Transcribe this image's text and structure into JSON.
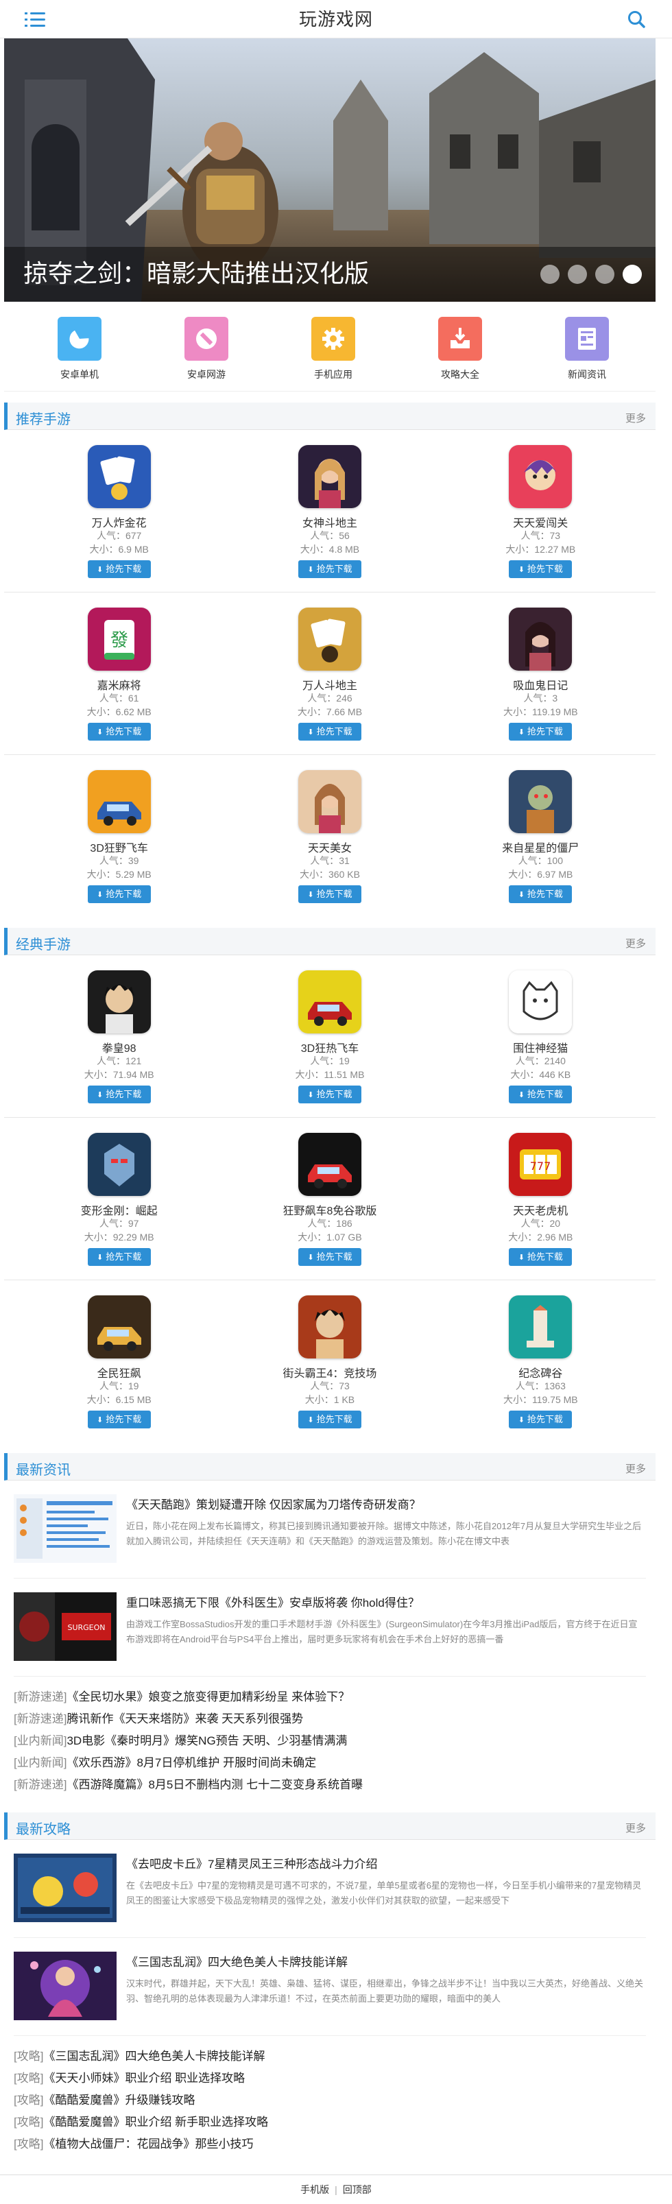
{
  "header": {
    "title": "玩游戏网"
  },
  "banner": {
    "caption": "掠夺之剑：暗影大陆推出汉化版",
    "dots": 4,
    "active_dot": 4
  },
  "quick": [
    {
      "label": "安卓单机",
      "color": "#4ab3f2",
      "icon": "pacman-icon"
    },
    {
      "label": "安卓网游",
      "color": "#ee8ac4",
      "icon": "tag-icon"
    },
    {
      "label": "手机应用",
      "color": "#f7b731",
      "icon": "gear-icon"
    },
    {
      "label": "攻略大全",
      "color": "#f46d5e",
      "icon": "inbox-icon"
    },
    {
      "label": "新闻资讯",
      "color": "#9a91e6",
      "icon": "document-icon"
    }
  ],
  "sections": {
    "recommend": {
      "title": "推荐手游",
      "more": "更多"
    },
    "classic": {
      "title": "经典手游",
      "more": "更多"
    },
    "news": {
      "title": "最新资讯",
      "more": "更多"
    },
    "guides": {
      "title": "最新攻略",
      "more": "更多"
    }
  },
  "download_label": "抢先下载",
  "popularity_prefix": "人气：",
  "size_prefix": "大小：",
  "recommend_apps": [
    {
      "name": "万人炸金花",
      "pop": "677",
      "size": "6.9 MB",
      "c1": "#2a5bb8",
      "c2": "#f2c23a",
      "icon": "cards-icon"
    },
    {
      "name": "女神斗地主",
      "pop": "56",
      "size": "4.8 MB",
      "c1": "#2b1f3a",
      "c2": "#d9a35b",
      "icon": "girl-icon"
    },
    {
      "name": "天天爱闯关",
      "pop": "73",
      "size": "12.27 MB",
      "c1": "#e8405a",
      "c2": "#6b3fa0",
      "icon": "character-icon"
    },
    {
      "name": "嘉米麻将",
      "pop": "61",
      "size": "6.62 MB",
      "c1": "#b3195a",
      "c2": "#f4d6e0",
      "icon": "mahjong-icon"
    },
    {
      "name": "万人斗地主",
      "pop": "246",
      "size": "7.66 MB",
      "c1": "#d4a33c",
      "c2": "#3b2a16",
      "icon": "cards-icon"
    },
    {
      "name": "吸血鬼日记",
      "pop": "3",
      "size": "119.19 MB",
      "c1": "#3a2230",
      "c2": "#b54d5c",
      "icon": "vampire-icon"
    },
    {
      "name": "3D狂野飞车",
      "pop": "39",
      "size": "5.29 MB",
      "c1": "#f1a020",
      "c2": "#2d5fb0",
      "icon": "car-icon"
    },
    {
      "name": "天天美女",
      "pop": "31",
      "size": "360 KB",
      "c1": "#e8c9a8",
      "c2": "#a86b3d",
      "icon": "girl-icon"
    },
    {
      "name": "来自星星的僵尸",
      "pop": "100",
      "size": "6.97 MB",
      "c1": "#314a6b",
      "c2": "#c27a34",
      "icon": "zombie-icon"
    }
  ],
  "classic_apps": [
    {
      "name": "拳皇98",
      "pop": "121",
      "size": "71.94 MB",
      "c1": "#1c1c1c",
      "c2": "#e8e8e8",
      "icon": "fighter-icon"
    },
    {
      "name": "3D狂热飞车",
      "pop": "19",
      "size": "11.51 MB",
      "c1": "#e6d21a",
      "c2": "#c02020",
      "icon": "car-icon"
    },
    {
      "name": "围住神经猫",
      "pop": "2140",
      "size": "446 KB",
      "c1": "#ffffff",
      "c2": "#333333",
      "icon": "cat-icon"
    },
    {
      "name": "变形金刚：崛起",
      "pop": "97",
      "size": "92.29 MB",
      "c1": "#1d3b5a",
      "c2": "#7da6cf",
      "icon": "robot-icon"
    },
    {
      "name": "狂野飙车8免谷歌版",
      "pop": "186",
      "size": "1.07 GB",
      "c1": "#121212",
      "c2": "#e03030",
      "icon": "car-icon"
    },
    {
      "name": "天天老虎机",
      "pop": "20",
      "size": "2.96 MB",
      "c1": "#c81a1a",
      "c2": "#f5c518",
      "icon": "slot-icon"
    },
    {
      "name": "全民狂飙",
      "pop": "19",
      "size": "6.15 MB",
      "c1": "#3a2a1a",
      "c2": "#e8b040",
      "icon": "car-icon"
    },
    {
      "name": "街头霸王4：竞技场",
      "pop": "73",
      "size": "1 KB",
      "c1": "#a83a1a",
      "c2": "#e8c08a",
      "icon": "fighter-icon"
    },
    {
      "name": "纪念碑谷",
      "pop": "1363",
      "size": "119.75 MB",
      "c1": "#1ba39c",
      "c2": "#f2e8d8",
      "icon": "monument-icon"
    }
  ],
  "news": [
    {
      "title": "《天天酷跑》策划疑遭开除 仅因家属为刀塔传奇研发商？",
      "summary": "近日，陈小花在网上发布长篇博文，称其已接到腾讯通知要被开除。据博文中陈述，陈小花自2012年7月从复旦大学研究生毕业之后就加入腾讯公司，并陆续担任《天天连萌》和《天天酷跑》的游戏运营及策划。陈小花在博文中表",
      "thumb": "light"
    },
    {
      "title": "重口味恶搞无下限《外科医生》安卓版将袭 你hold得住？",
      "summary": "由游戏工作室BossaStudios开发的重口手术题材手游《外科医生》(SurgeonSimulator)在今年3月推出iPad版后，官方终于在近日宣布游戏即将在Android平台与PS4平台上推出，届时更多玩家将有机会在手术台上好好的恶搞一番",
      "thumb": "surgeon"
    }
  ],
  "news_links": [
    {
      "tag": "[新游速递]",
      "text": "《全民切水果》娘变之旅变得更加精彩纷呈 来体验下？"
    },
    {
      "tag": "[新游速递]",
      "text": "腾讯新作《天天来塔防》来袭 天天系列很强势"
    },
    {
      "tag": "[业内新闻]",
      "text": "3D电影《秦时明月》爆笑NG预告 天明、少羽基情满满"
    },
    {
      "tag": "[业内新闻]",
      "text": "《欢乐西游》8月7日停机维护 开服时间尚未确定"
    },
    {
      "tag": "[新游速递]",
      "text": "《西游降魔篇》8月5日不删档内测 七十二变变身系统首曝"
    }
  ],
  "guides": [
    {
      "title": "《去吧皮卡丘》7星精灵凤王三种形态战斗力介绍",
      "summary": "在《去吧皮卡丘》中7星的宠物精灵是可遇不可求的，不说7星，单单5星或者6星的宠物也一样，今日至手机小编带来的7星宠物精灵凤王的图鉴让大家感受下极品宠物精灵的强悍之处，激发小伙伴们对其获取的欲望，一起来感受下",
      "thumb": "pika"
    },
    {
      "title": "《三国志乱润》四大绝色美人卡牌技能详解",
      "summary": "汉末时代，群雄并起，天下大乱！英雄、枭雄、猛将、谋臣，相继辈出，争锋之战半步不让！当中我以三大英杰，好绝善战、义绝关羽、智绝孔明的总体表现最为人津津乐道！不过，在英杰前面上要更功勋的耀眼，暗面中的美人",
      "thumb": "beauty"
    }
  ],
  "guide_links": [
    {
      "tag": "[攻略]",
      "text": "《三国志乱润》四大绝色美人卡牌技能详解"
    },
    {
      "tag": "[攻略]",
      "text": "《天天小师妹》职业介绍 职业选择攻略"
    },
    {
      "tag": "[攻略]",
      "text": "《酷酷爱魔兽》升级赚钱攻略"
    },
    {
      "tag": "[攻略]",
      "text": "《酷酷爱魔兽》职业介绍 新手职业选择攻略"
    },
    {
      "tag": "[攻略]",
      "text": "《植物大战僵尸：花园战争》那些小技巧"
    }
  ],
  "footer": {
    "mobile": "手机版",
    "top": "回顶部",
    "sep": "|"
  },
  "colors": {
    "accent": "#2d8fd5"
  }
}
